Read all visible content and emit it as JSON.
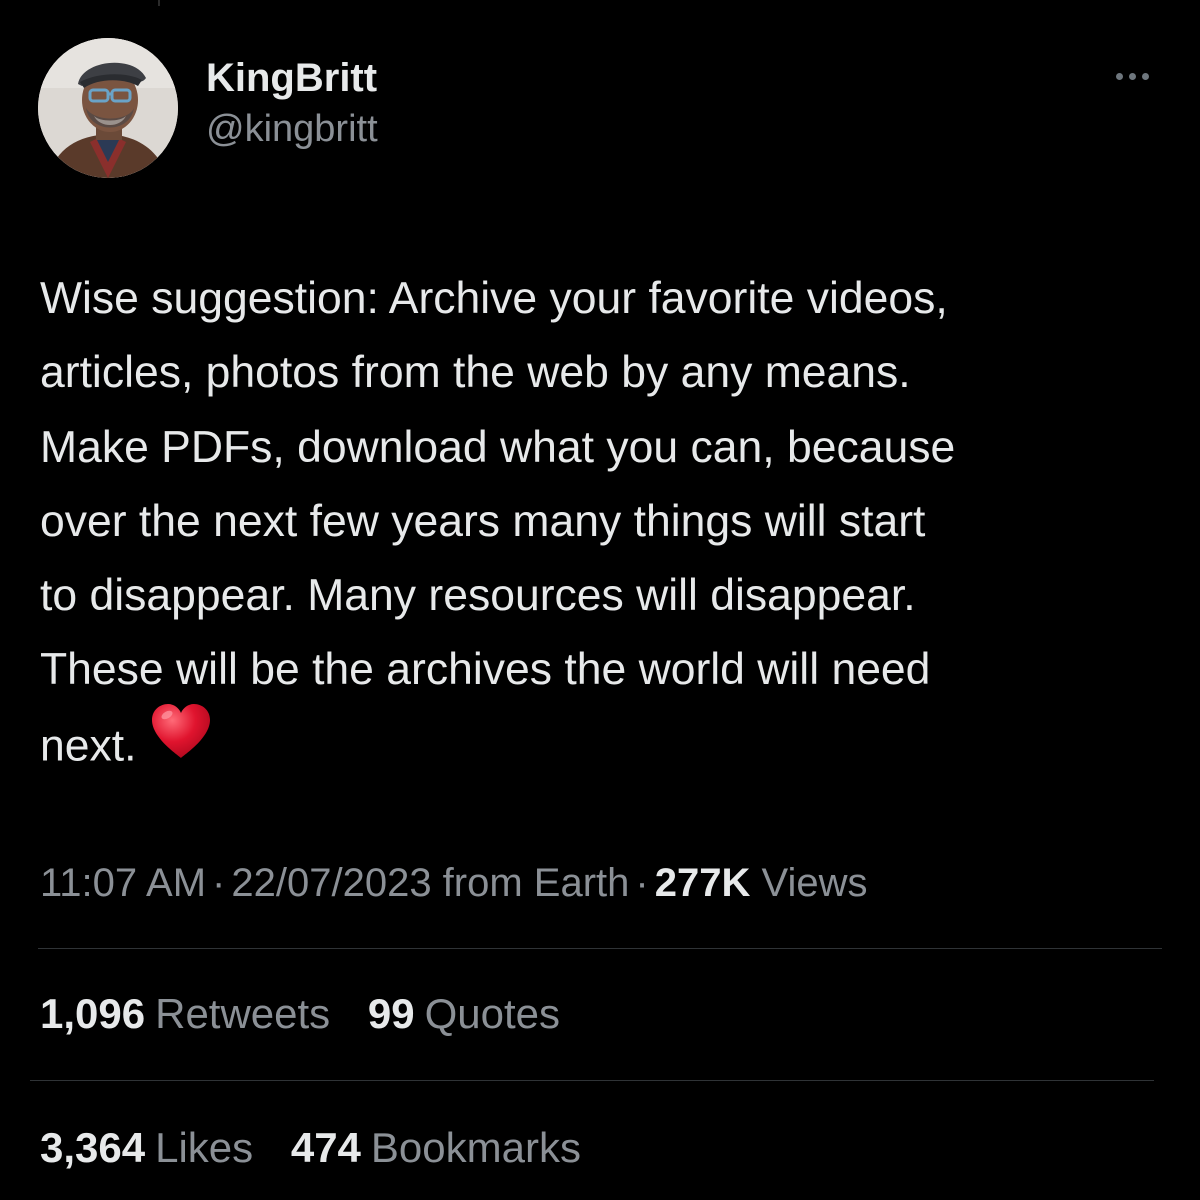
{
  "author": {
    "display_name": "KingBritt",
    "handle": "@kingbritt"
  },
  "menu": {
    "icon": "more-horizontal-icon"
  },
  "tweet": {
    "lines": [
      "Wise suggestion: Archive your favorite videos,",
      "articles, photos from the web by any means.",
      "Make PDFs, download what you can, because",
      "over the next few years many things will start",
      "to disappear. Many resources will disappear.",
      "These will be the archives the world will need",
      "next."
    ],
    "emoji": "red-heart-icon",
    "emoji_color": "#e0142e"
  },
  "meta": {
    "time": "11:07 AM",
    "separator": "·",
    "date_source": "22/07/2023 from Earth",
    "views_count": "277K",
    "views_label": "Views"
  },
  "stats": {
    "retweets_count": "1,096",
    "retweets_label": "Retweets",
    "quotes_count": "99",
    "quotes_label": "Quotes",
    "likes_count": "3,364",
    "likes_label": "Likes",
    "bookmarks_count": "474",
    "bookmarks_label": "Bookmarks"
  },
  "colors": {
    "background": "#000000",
    "primary_text": "#e7e9ea",
    "secondary_text": "#8b9096",
    "divider": "#2f3336"
  }
}
